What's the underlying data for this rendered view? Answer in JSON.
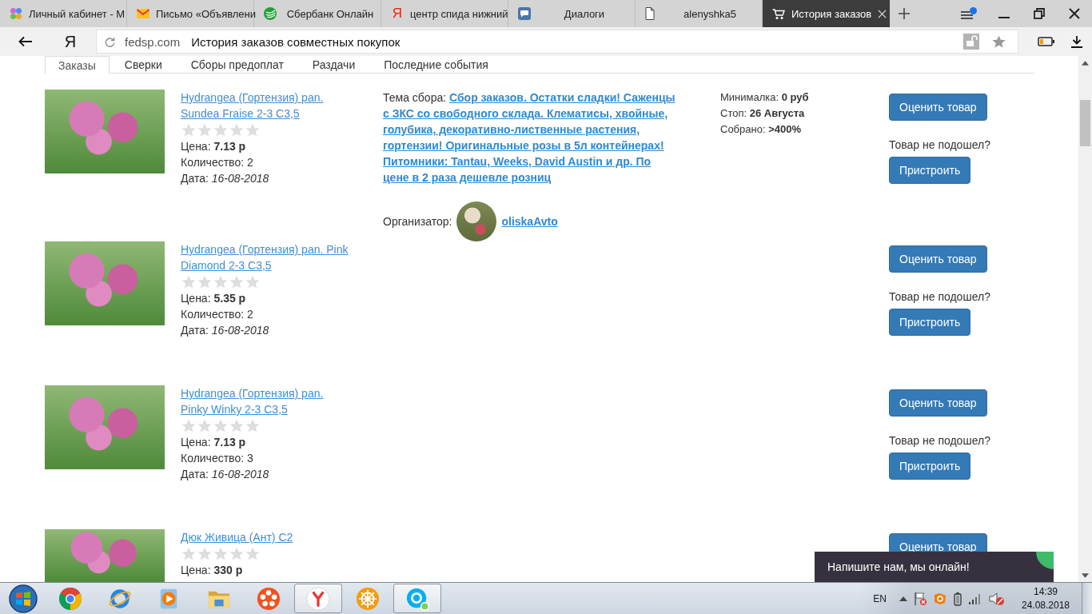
{
  "browser": {
    "tabs": [
      {
        "kind": "dots",
        "title": "Личный кабинет - М",
        "selected": false
      },
      {
        "kind": "mail",
        "title": "Письмо «Объявлени",
        "selected": false
      },
      {
        "kind": "bank",
        "title": "Сбербанк Онлайн",
        "selected": false
      },
      {
        "kind": "glyph",
        "glyph": "Я",
        "title": "центр спида нижний",
        "selected": false
      },
      {
        "kind": "chat",
        "title": "Диалоги",
        "selected": false
      },
      {
        "kind": "page",
        "title": "alenyshka5",
        "selected": false
      },
      {
        "kind": "cart",
        "title": "История заказов",
        "selected": true
      }
    ],
    "home_button": "Я",
    "address": {
      "domain": "fedsp.com",
      "title": "История заказов совместных покупок"
    }
  },
  "page_tabs": [
    {
      "label": "Заказы",
      "selected": true
    },
    {
      "label": "Сверки",
      "selected": false
    },
    {
      "label": "Сборы предоплат",
      "selected": false
    },
    {
      "label": "Раздачи",
      "selected": false
    },
    {
      "label": "Последние события",
      "selected": false
    }
  ],
  "orders": [
    {
      "title": "Hydrangea (Гортензия) pan. Sundea Fraise 2-3 C3,5",
      "stars": 0,
      "price": "Цена: **7.13 р**",
      "quantity": "Количество: 2",
      "date": "Дата: *16-08-2018*",
      "collection": {
        "topic_label": "Тема сбора:",
        "topic": "Сбор заказов. Остатки сладки! Саженцы с ЗКС со свободного склада. Клематисы, хвойные, голубика, декоративно-лиственные растения, гортензии! Оригинальные розы в 5л контейнерах! Питомники: Tantau, Weeks, David Austin и др. По цене в 2 раза дешевле розниц",
        "organizer_label": "Организатор:",
        "organizer": "oliskaAvto",
        "stats": [
          "Минималка: **0 руб**",
          "Стоп: **26 Августа**",
          "Собрано: **>400%**"
        ]
      },
      "rate_button": "Оценить товар",
      "not_fit": "Товар не подошел?",
      "reassign_button": "Пристроить"
    },
    {
      "title": "Hydrangea (Гортензия) pan. Pink Diamond 2-3 C3,5",
      "stars": 0,
      "price": "Цена: **5.35 р**",
      "quantity": "Количество: 2",
      "date": "Дата: *16-08-2018*",
      "rate_button": "Оценить товар",
      "not_fit": "Товар не подошел?",
      "reassign_button": "Пристроить"
    },
    {
      "title": "Hydrangea (Гортензия) pan. Pinky Winky 2-3 C3,5",
      "stars": 0,
      "price": "Цена: **7.13 р**",
      "quantity": "Количество: 3",
      "date": "Дата: *16-08-2018*",
      "rate_button": "Оценить товар",
      "not_fit": "Товар не подошел?",
      "reassign_button": "Пристроить"
    },
    {
      "title": "Дюк Живица (Ант) C2",
      "stars": 0,
      "price": "Цена: **330 р**",
      "rate_button": "Оценить товар"
    }
  ],
  "chat_widget": {
    "text": "Напишите нам, мы онлайн!"
  },
  "taskbar": {
    "apps": [
      {
        "kind": "roundbrowser",
        "running": false
      },
      {
        "kind": "orbitbrowser",
        "running": false
      },
      {
        "kind": "player",
        "running": false
      },
      {
        "kind": "folder",
        "running": false
      },
      {
        "kind": "reel",
        "running": false
      },
      {
        "kind": "ybrowser",
        "running": true
      },
      {
        "kind": "wheel",
        "running": false
      },
      {
        "kind": "messenger",
        "running": true
      }
    ],
    "language": "EN",
    "time": "14:39",
    "date": "24.08.2018"
  }
}
